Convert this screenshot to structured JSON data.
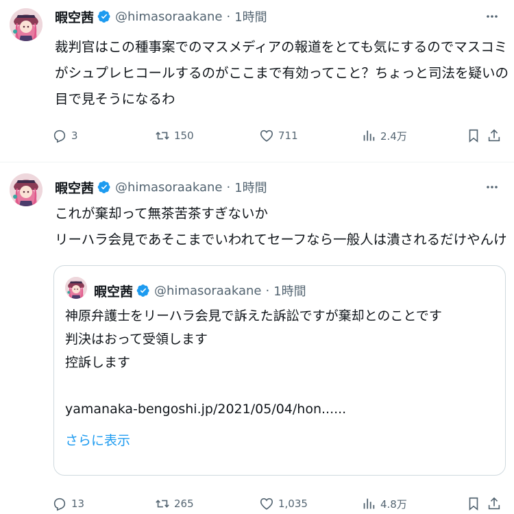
{
  "tweets": [
    {
      "author": {
        "name": "暇空茜",
        "handle": "@himasoraakane",
        "time": "1時間"
      },
      "text_lines": [
        "裁判官はこの種事案でのマスメディアの報道をとても気にするのでマスコミ",
        "がシュプレヒコールするのがここまで有効ってこと？ちょっと司法を疑いの",
        "目で見そうになるわ"
      ],
      "stats": {
        "replies": "3",
        "retweets": "150",
        "likes": "711",
        "views": "2.4万"
      }
    },
    {
      "author": {
        "name": "暇空茜",
        "handle": "@himasoraakane",
        "time": "1時間"
      },
      "text_lines": [
        "これが棄却って無茶苦茶すぎないか",
        "リーハラ会見であそこまでいわれてセーフなら一般人は潰されるだけやんけ"
      ],
      "quote": {
        "author": {
          "name": "暇空茜",
          "handle": "@himasoraakane",
          "time": "1時間"
        },
        "text_lines": [
          "神原弁護士をリーハラ会見で訴えた訴訟ですが棄却とのことです",
          "判決はおって受領します",
          "控訴します",
          "",
          "yamanaka-bengoshi.jp/2021/05/04/hon......"
        ],
        "show_more": "さらに表示"
      },
      "stats": {
        "replies": "13",
        "retweets": "265",
        "likes": "1,035",
        "views": "4.8万"
      }
    }
  ],
  "colors": {
    "text": "#0f1419",
    "secondary": "#536471",
    "accent": "#1d9bf0",
    "border": "#cfd9de",
    "divider": "#eff3f4"
  },
  "icons": [
    "verified-badge-icon",
    "more-icon",
    "reply-icon",
    "retweet-icon",
    "like-icon",
    "views-icon",
    "bookmark-icon",
    "share-icon"
  ]
}
